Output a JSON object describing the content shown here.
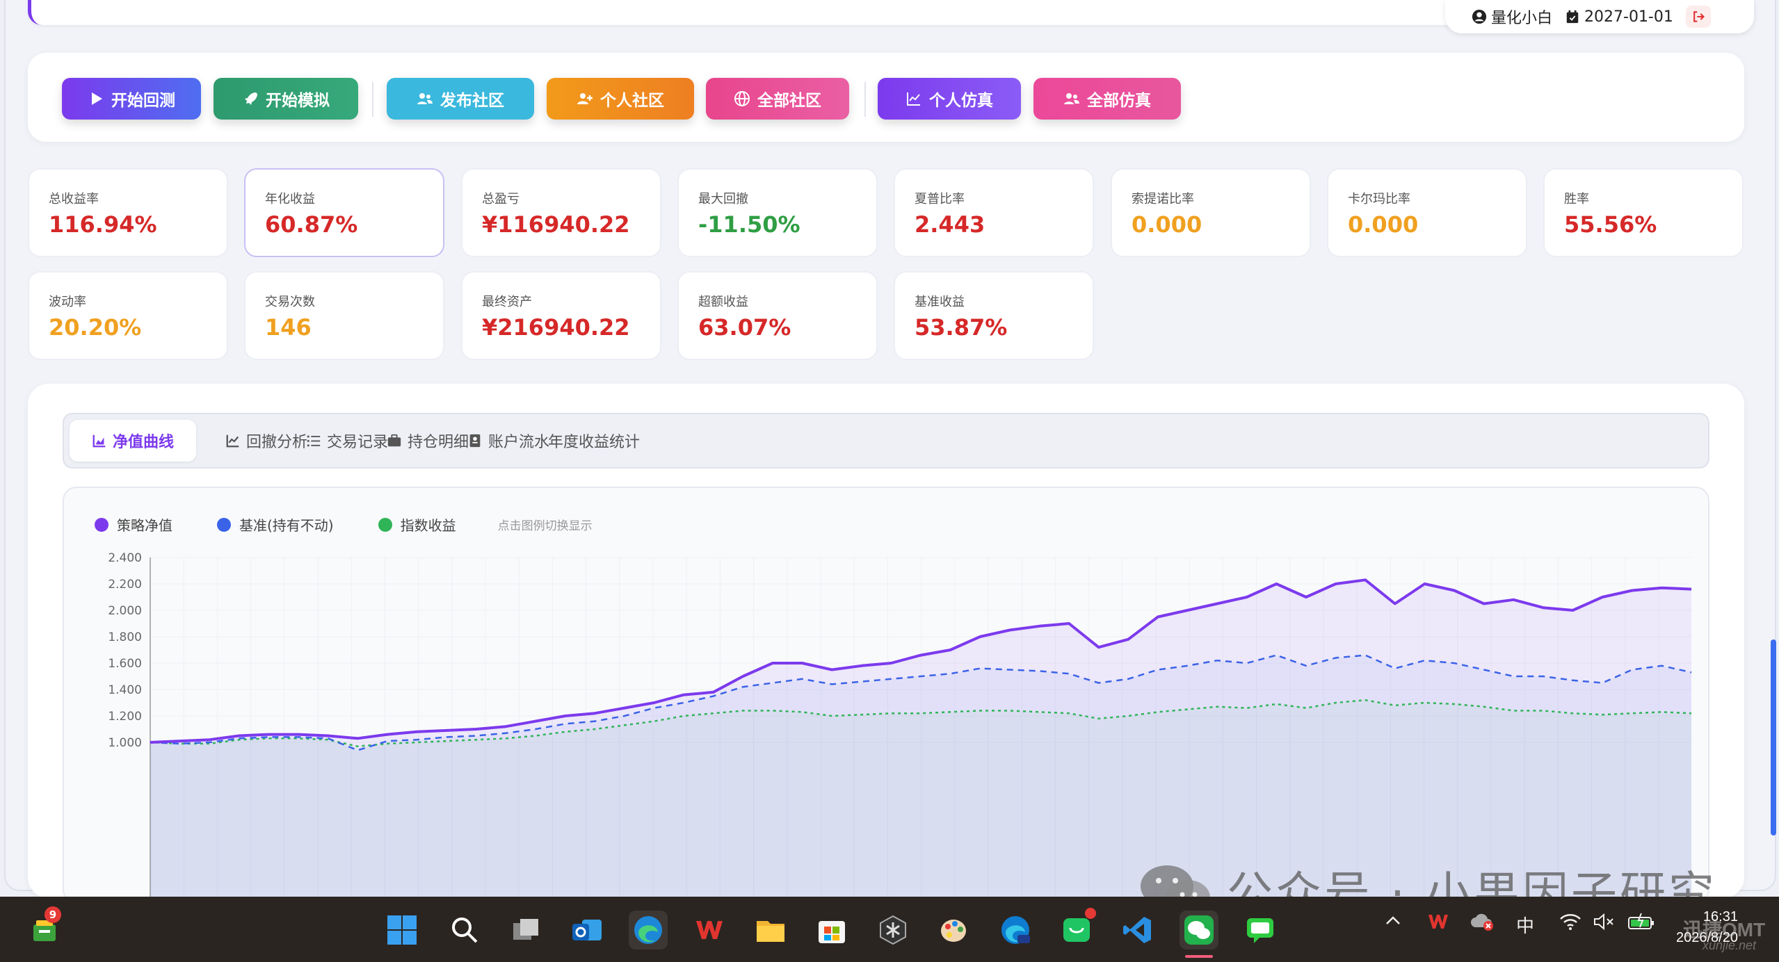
{
  "header": {
    "username": "量化小白",
    "date": "2027-01-01"
  },
  "toolbar": {
    "buttons": [
      {
        "label": "开始回测",
        "icon": "play-icon",
        "color": "#6d4aed"
      },
      {
        "label": "开始模拟",
        "icon": "rocket-icon",
        "color": "#2e9a6e"
      },
      {
        "label": "发布社区",
        "icon": "users-icon",
        "color": "#3ab8dd"
      },
      {
        "label": "个人社区",
        "icon": "user-plus-icon",
        "color": "#f08c1a"
      },
      {
        "label": "全部社区",
        "icon": "globe-icon",
        "color": "#e6508f"
      },
      {
        "label": "个人仿真",
        "icon": "chart-line-icon",
        "color": "#7c3aed"
      },
      {
        "label": "全部仿真",
        "icon": "users-icon",
        "color": "#ec4899"
      }
    ]
  },
  "metrics": [
    {
      "label": "总收益率",
      "value": "116.94%",
      "color": "#d62828"
    },
    {
      "label": "年化收益",
      "value": "60.87%",
      "color": "#d62828"
    },
    {
      "label": "总盈亏",
      "value": "¥116940.22",
      "color": "#d62828"
    },
    {
      "label": "最大回撤",
      "value": "-11.50%",
      "color": "#2f9e44"
    },
    {
      "label": "夏普比率",
      "value": "2.443",
      "color": "#d62828"
    },
    {
      "label": "索提诺比率",
      "value": "0.000",
      "color": "#f0a020"
    },
    {
      "label": "卡尔玛比率",
      "value": "0.000",
      "color": "#f0a020"
    },
    {
      "label": "胜率",
      "value": "55.56%",
      "color": "#d62828"
    },
    {
      "label": "波动率",
      "value": "20.20%",
      "color": "#f0a020"
    },
    {
      "label": "交易次数",
      "value": "146",
      "color": "#f0a020"
    },
    {
      "label": "最终资产",
      "value": "¥216940.22",
      "color": "#d62828"
    },
    {
      "label": "超额收益",
      "value": "63.07%",
      "color": "#d62828"
    },
    {
      "label": "基准收益",
      "value": "53.87%",
      "color": "#d62828"
    }
  ],
  "tabs": [
    {
      "label": "净值曲线",
      "icon": "area-chart-icon",
      "active": true
    },
    {
      "label": "回撤分析",
      "icon": "line-chart-icon",
      "active": false
    },
    {
      "label": "交易记录",
      "icon": "list-icon",
      "active": false
    },
    {
      "label": "持仓明细",
      "icon": "briefcase-icon",
      "active": false
    },
    {
      "label": "账户流水",
      "icon": "ledger-icon",
      "active": false
    },
    {
      "label": "年度收益统计",
      "icon": "",
      "active": false
    }
  ],
  "chart_data": {
    "type": "line",
    "legend": [
      {
        "name": "策略净值",
        "color": "#7c3aed"
      },
      {
        "name": "基准(持有不动)",
        "color": "#3b63e8"
      },
      {
        "name": "指数收益",
        "color": "#2fb457"
      }
    ],
    "legend_hint": "点击图例切换显示",
    "y_ticks": [
      "2.400",
      "2.200",
      "2.000",
      "1.800",
      "1.600",
      "1.400",
      "1.200",
      "1.000"
    ],
    "ylim": [
      0.85,
      2.4
    ],
    "x_points": 53,
    "series": [
      {
        "name": "策略净值",
        "style": "solid",
        "values": [
          1.0,
          1.01,
          1.02,
          1.05,
          1.06,
          1.06,
          1.05,
          1.03,
          1.06,
          1.08,
          1.09,
          1.1,
          1.12,
          1.16,
          1.2,
          1.22,
          1.26,
          1.3,
          1.36,
          1.38,
          1.5,
          1.6,
          1.6,
          1.55,
          1.58,
          1.6,
          1.66,
          1.7,
          1.8,
          1.85,
          1.88,
          1.9,
          1.72,
          1.78,
          1.95,
          2.0,
          2.05,
          2.1,
          2.2,
          2.1,
          2.2,
          2.23,
          2.05,
          2.2,
          2.15,
          2.05,
          2.08,
          2.02,
          2.0,
          2.1,
          2.15,
          2.17,
          2.16
        ]
      },
      {
        "name": "基准(持有不动)",
        "style": "dashed",
        "values": [
          1.0,
          0.99,
          1.0,
          1.03,
          1.04,
          1.04,
          1.03,
          0.94,
          1.01,
          1.02,
          1.04,
          1.05,
          1.07,
          1.1,
          1.14,
          1.16,
          1.2,
          1.26,
          1.3,
          1.35,
          1.42,
          1.45,
          1.48,
          1.44,
          1.46,
          1.48,
          1.5,
          1.52,
          1.56,
          1.55,
          1.54,
          1.52,
          1.45,
          1.48,
          1.55,
          1.58,
          1.62,
          1.6,
          1.66,
          1.58,
          1.64,
          1.66,
          1.56,
          1.62,
          1.6,
          1.55,
          1.5,
          1.5,
          1.47,
          1.45,
          1.55,
          1.58,
          1.53
        ]
      },
      {
        "name": "指数收益",
        "style": "dotted",
        "values": [
          1.0,
          0.99,
          0.99,
          1.02,
          1.03,
          1.03,
          1.02,
          0.97,
          0.99,
          1.0,
          1.01,
          1.02,
          1.03,
          1.05,
          1.08,
          1.1,
          1.13,
          1.16,
          1.2,
          1.22,
          1.24,
          1.24,
          1.23,
          1.2,
          1.21,
          1.22,
          1.22,
          1.23,
          1.24,
          1.24,
          1.23,
          1.22,
          1.18,
          1.2,
          1.23,
          1.25,
          1.27,
          1.26,
          1.29,
          1.26,
          1.3,
          1.32,
          1.28,
          1.3,
          1.29,
          1.27,
          1.24,
          1.24,
          1.22,
          1.21,
          1.22,
          1.23,
          1.22
        ]
      }
    ]
  },
  "watermark": "公众号 · 小果因子研究",
  "taskbar": {
    "notification_count": "9",
    "time": "16:31",
    "date": "2026/8/20",
    "ime": "中",
    "watermark_top": "迅捷OMT",
    "watermark_bottom": "xunjie.net"
  }
}
